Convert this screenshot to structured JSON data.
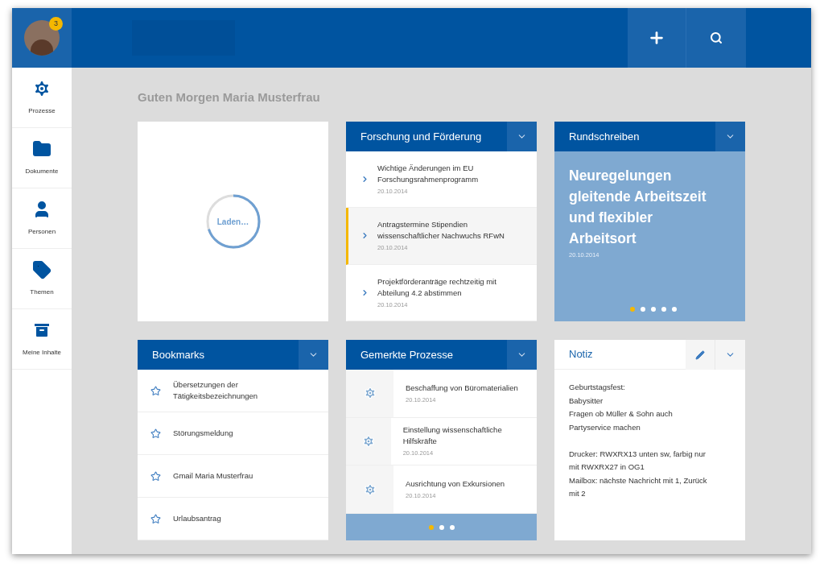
{
  "header": {
    "notification_badge": "3"
  },
  "sidebar": {
    "items": [
      {
        "kind": "gear",
        "label": "Prozesse"
      },
      {
        "kind": "folder",
        "label": "Dokumente"
      },
      {
        "kind": "person",
        "label": "Personen"
      },
      {
        "kind": "tag",
        "label": "Themen"
      },
      {
        "kind": "archive",
        "label": "Meine Inhalte"
      }
    ]
  },
  "greeting": "Guten Morgen Maria Musterfrau",
  "loading_card": {
    "label": "Laden…"
  },
  "research_card": {
    "title": "Forschung und Förderung",
    "items": [
      {
        "title": "Wichtige Änderungen im EU Forschungsrahmenprogramm",
        "date": "20.10.2014",
        "selected": false
      },
      {
        "title": "Antragstermine Stipendien wissenschaftlicher Nachwuchs RFwN",
        "date": "20.10.2014",
        "selected": true
      },
      {
        "title": "Projektförderanträge rechtzeitig mit Abteilung 4.2 abstimmen",
        "date": "20.10.2014",
        "selected": false
      }
    ]
  },
  "circular_card": {
    "title": "Rundschreiben",
    "headline": "Neuregelungen gleitende Arbeitszeit und flexibler Arbeitsort",
    "date": "20.10.2014",
    "dots": [
      {
        "selected": true
      },
      {
        "selected": false
      },
      {
        "selected": false
      },
      {
        "selected": false
      },
      {
        "selected": false
      }
    ]
  },
  "bookmarks_card": {
    "title": "Bookmarks",
    "items": [
      "Übersetzungen der Tätigkeitsbezeichnungen",
      "Störungsmeldung",
      "Gmail Maria Musterfrau",
      "Urlaubsantrag"
    ]
  },
  "processes_card": {
    "title": "Gemerkte Prozesse",
    "items": [
      {
        "title": "Beschaffung von Büromaterialien",
        "date": "20.10.2014"
      },
      {
        "title": "Einstellung wissenschaftliche Hilfskräfte",
        "date": "20.10.2014"
      },
      {
        "title": "Ausrichtung von Exkursionen",
        "date": "20.10.2014"
      }
    ],
    "dots": [
      {
        "selected": true
      },
      {
        "selected": false
      },
      {
        "selected": false
      }
    ]
  },
  "note_card": {
    "title": "Notiz",
    "paragraphs": [
      [
        "Geburtstagsfest:",
        "Babysitter",
        "Fragen ob Müller & Sohn auch",
        "Partyservice machen"
      ],
      [
        "Drucker: RWXRX13 unten sw, farbig nur",
        "mit RWXRX27 in OG1",
        "Mailbox: nächste Nachricht mit 1, Zurück",
        "mit 2"
      ]
    ]
  }
}
